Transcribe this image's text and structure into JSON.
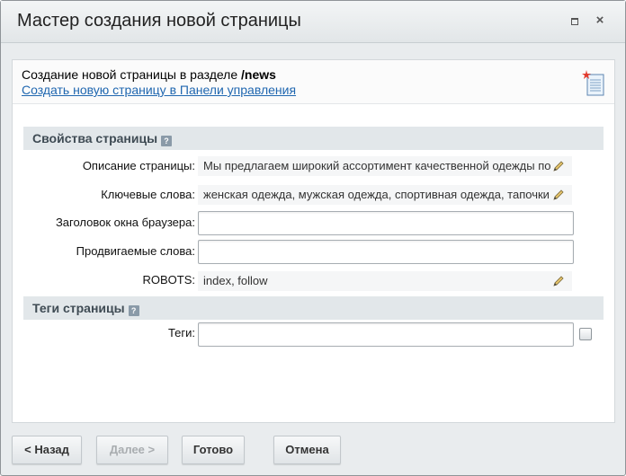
{
  "window": {
    "title": "Мастер создания новой страницы",
    "maximize_icon": "maximize-icon",
    "close_icon": "close-icon",
    "close_glyph": "×"
  },
  "header": {
    "text_prefix": "Создание новой страницы в разделе ",
    "section_path": "/news",
    "link_text": "Создать новую страницу в Панели управления",
    "icon": "new-document-icon"
  },
  "page_properties": {
    "title": "Свойства страницы",
    "help_glyph": "?",
    "fields": {
      "description": {
        "label": "Описание страницы:",
        "value": "Мы предлагаем широкий ассортимент качественной одежды по"
      },
      "keywords": {
        "label": "Ключевые слова:",
        "value": "женская одежда, мужская одежда, спортивная одежда, тапочки"
      },
      "browser_title": {
        "label": "Заголовок окна браузера:",
        "value": ""
      },
      "promoted_words": {
        "label": "Продвигаемые слова:",
        "value": ""
      },
      "robots": {
        "label": "ROBOTS:",
        "value": "index, follow"
      }
    }
  },
  "page_tags": {
    "title": "Теги страницы",
    "help_glyph": "?",
    "tags_label": "Теги:",
    "tags_value": ""
  },
  "buttons": {
    "back": "< Назад",
    "next": "Далее >",
    "done": "Готово",
    "cancel": "Отмена"
  },
  "colors": {
    "link": "#2067b0",
    "section_bg": "#e2e7ea",
    "window_bg": "#e9ecee"
  }
}
